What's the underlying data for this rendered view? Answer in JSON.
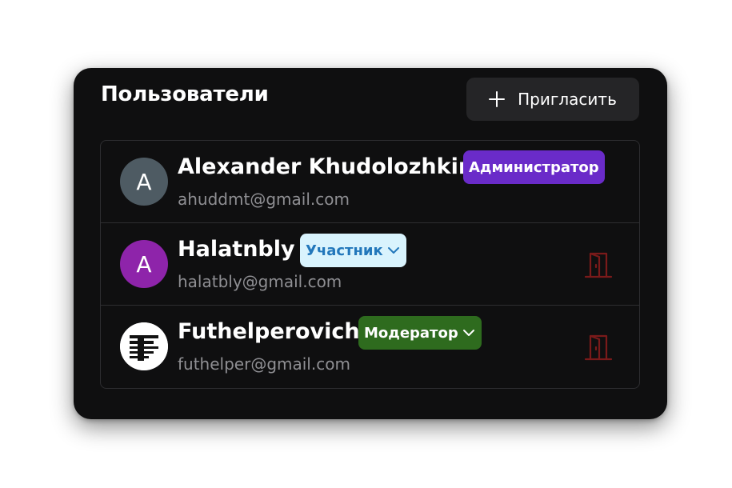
{
  "panel": {
    "title": "Пользователи",
    "invite_label": "Пригласить"
  },
  "users": [
    {
      "avatar_letter": "A",
      "avatar_color": "#4e5b63",
      "name": "Alexander Khudolozhkin",
      "email": "ahuddmt@gmail.com",
      "role": "Администратор",
      "role_bg": "#6a2bc9",
      "role_fg": "#ffffff",
      "role_dropdown": false,
      "can_kick": false
    },
    {
      "avatar_letter": "A",
      "avatar_color": "#8e24aa",
      "name": "Halatnbly",
      "email": "halatbly@gmail.com",
      "role": "Участник",
      "role_bg": "#d9f3fd",
      "role_fg": "#2277bb",
      "role_dropdown": true,
      "can_kick": true
    },
    {
      "avatar_letter": "",
      "avatar_icon": "futhelper-logo-icon",
      "name": "Futhelperovich",
      "email": "futhelper@gmail.com",
      "role": "Модератор",
      "role_bg": "#2e6b1e",
      "role_fg": "#ffffff",
      "role_dropdown": true,
      "can_kick": true
    }
  ],
  "icons": {
    "invite": "plus-icon",
    "kick": "exit-door-icon",
    "dropdown": "chevron-down-icon"
  },
  "colors": {
    "card_bg": "#0f0f10",
    "kick_icon": "#7a1a1a"
  }
}
